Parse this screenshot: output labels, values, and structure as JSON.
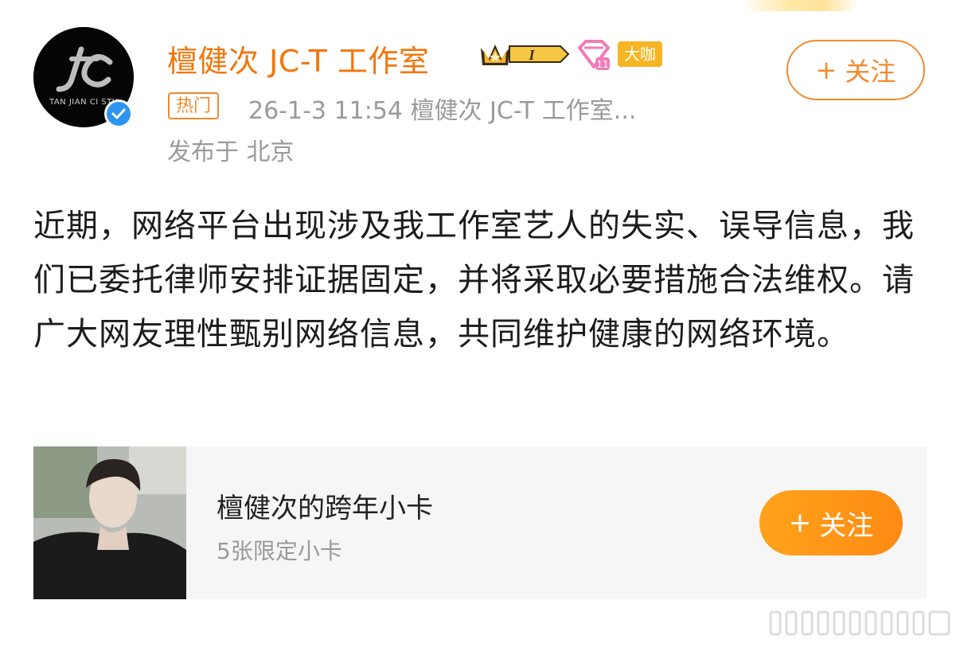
{
  "author": {
    "name": "檀健次 JC-T 工作室",
    "avatar_text": "TAN JIAN CI STU",
    "badge_big": "大咖",
    "crown_level": "I",
    "follow_label": "关注",
    "follow_plus": "+"
  },
  "post": {
    "tag": "热门",
    "meta": "26-1-3 11:54  檀健次 JC-T 工作室...",
    "location": "发布于 北京",
    "content": "近期，网络平台出现涉及我工作室艺人的失实、误导信息，我们已委托律师安排证据固定，并将采取必要措施合法维权。请广大网友理性甄别网络信息，共同维护健康的网络环境。"
  },
  "card": {
    "title": "檀健次的跨年小卡",
    "subtitle": "5张限定小卡",
    "follow_label": "关注",
    "follow_plus": "+"
  },
  "colors": {
    "accent": "#f2760d",
    "verified": "#2d95ef",
    "big_badge": "#f6b523",
    "follow_card": "#ff9a18"
  }
}
